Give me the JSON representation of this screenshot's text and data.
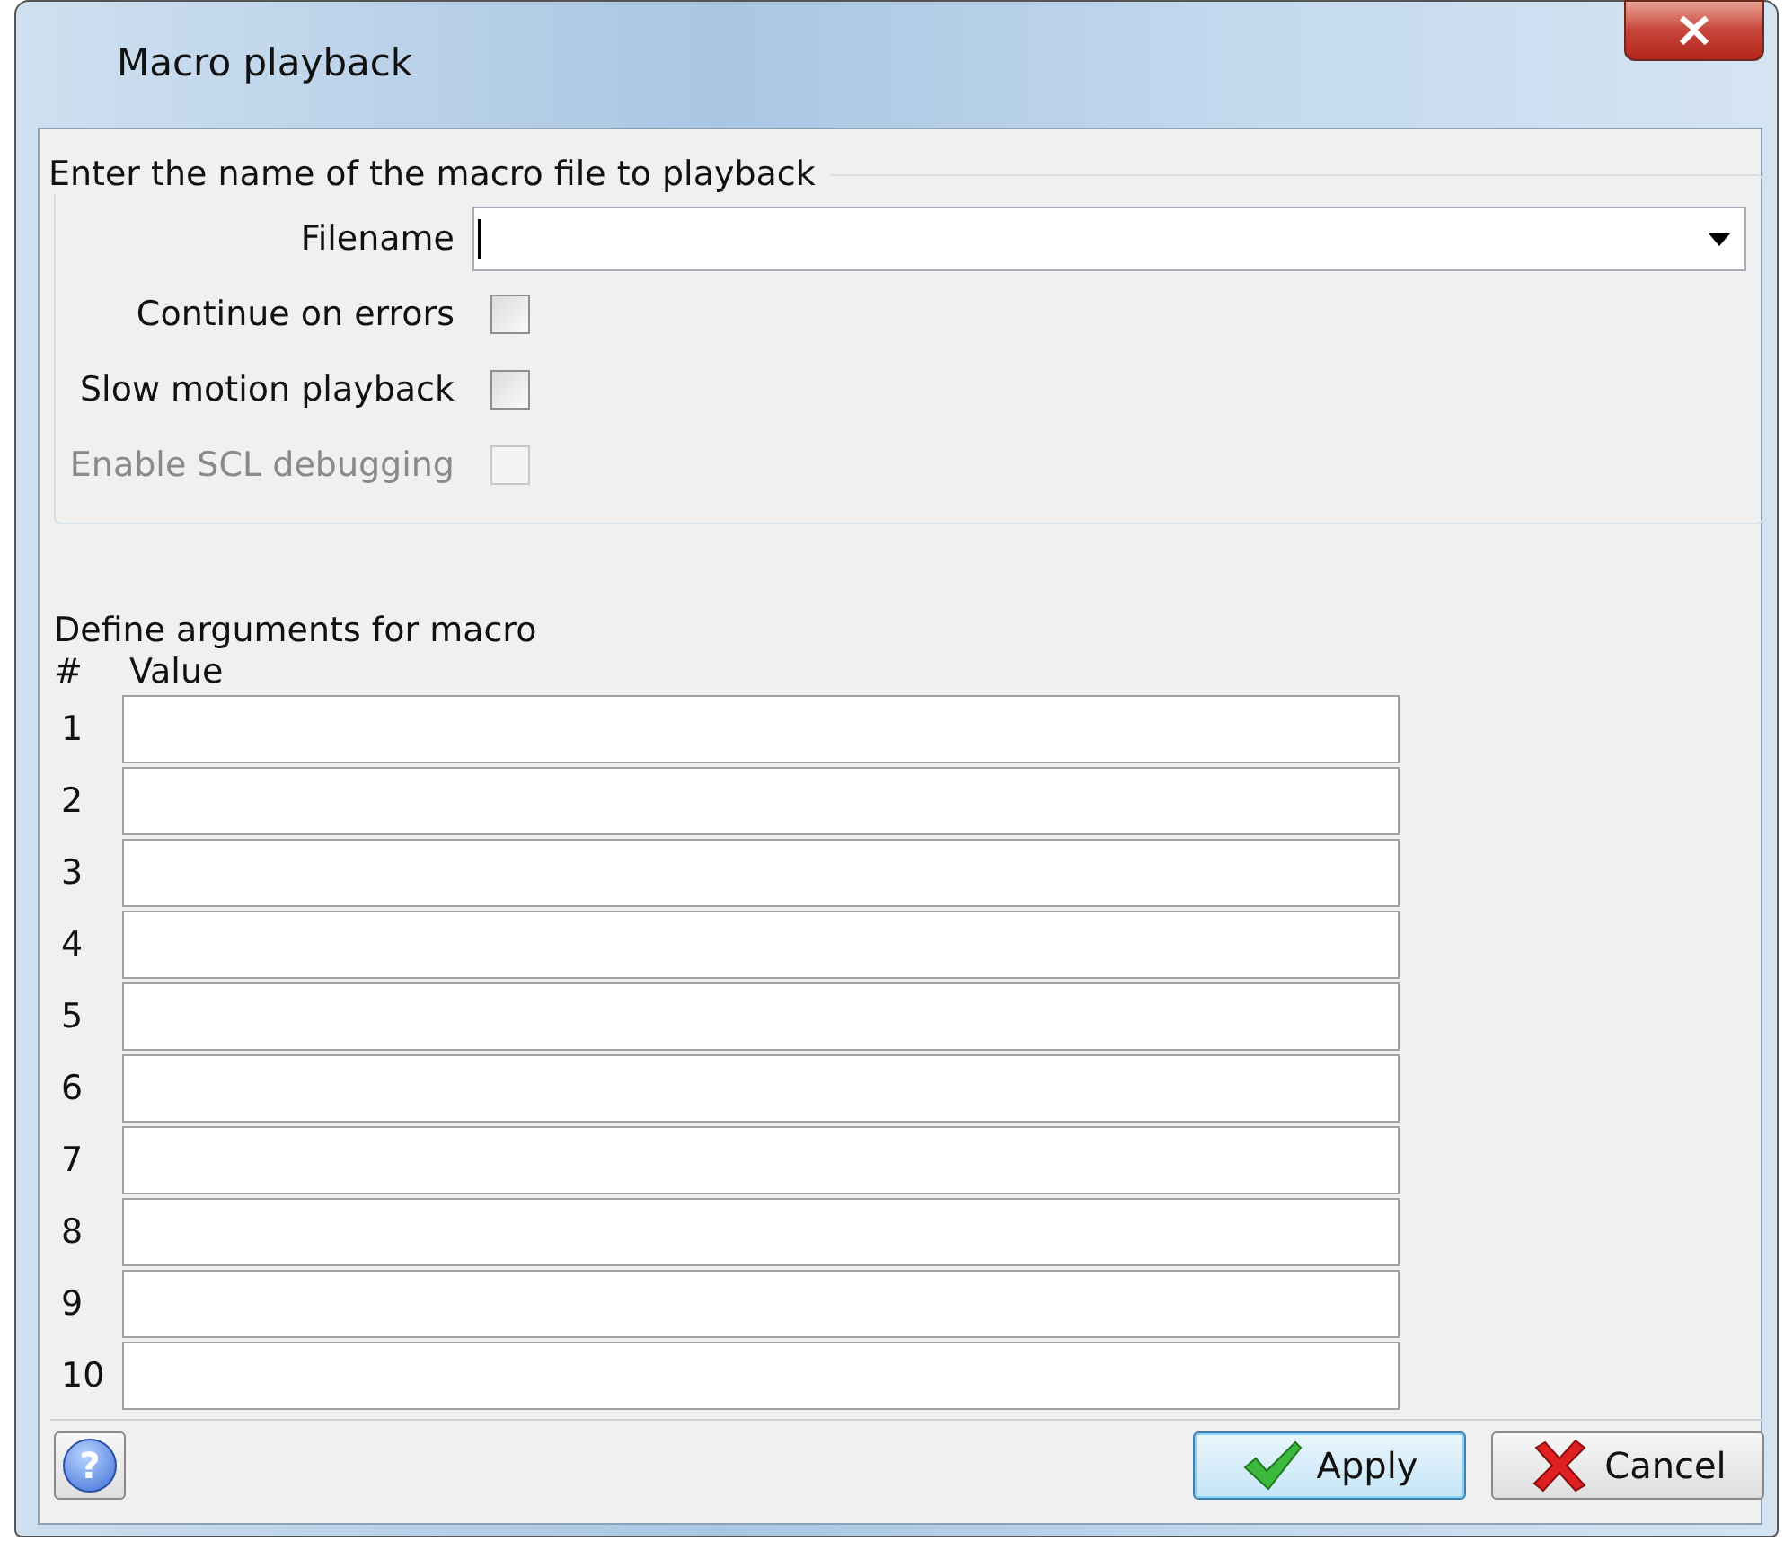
{
  "window": {
    "title": "Macro playback"
  },
  "file_group": {
    "legend": "Enter the name of the macro file to playback",
    "filename_label": "Filename"
  },
  "options": [
    {
      "label": "Continue on errors",
      "checked": false,
      "disabled": false
    },
    {
      "label": "Slow motion playback",
      "checked": false,
      "disabled": false
    },
    {
      "label": "Enable SCL debugging",
      "checked": false,
      "disabled": true
    }
  ],
  "arguments": {
    "title": "Define arguments for macro",
    "columns": [
      "#",
      "Value"
    ],
    "rows": [
      {
        "number": "1"
      },
      {
        "number": "2"
      },
      {
        "number": "3"
      },
      {
        "number": "4"
      },
      {
        "number": "5"
      },
      {
        "number": "6"
      },
      {
        "number": "7"
      },
      {
        "number": "8"
      },
      {
        "number": "9"
      },
      {
        "number": "10"
      }
    ]
  },
  "footer": {
    "help": "?",
    "buttons": [
      {
        "label": "Apply",
        "kind": "apply",
        "selected": true
      },
      {
        "label": "Cancel",
        "kind": "cancel",
        "selected": false
      }
    ]
  }
}
